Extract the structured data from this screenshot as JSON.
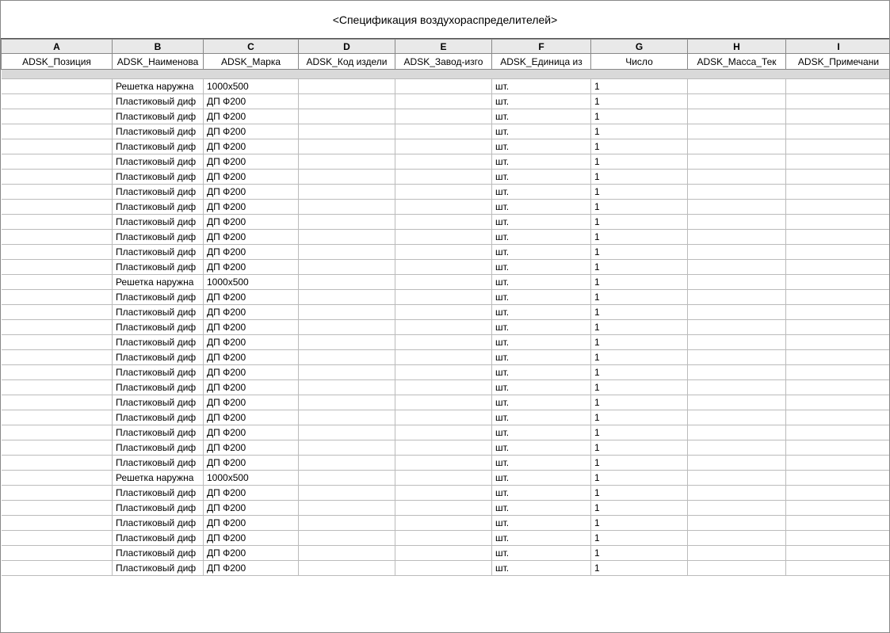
{
  "title": "<Спецификация воздухораспределителей>",
  "column_letters": [
    "A",
    "B",
    "C",
    "D",
    "E",
    "F",
    "G",
    "H",
    "I"
  ],
  "column_fields": [
    "ADSK_Позиция",
    "ADSK_Наименова",
    "ADSK_Марка",
    "ADSK_Код издели",
    "ADSK_Завод-изго",
    "ADSK_Единица из",
    "Число",
    "ADSK_Масса_Тек",
    "ADSK_Примечани"
  ],
  "rows": [
    {
      "sep": true
    },
    {
      "B": "Решетка наружна",
      "C": "1000x500",
      "F": "шт.",
      "G": "1"
    },
    {
      "B": "Пластиковый диф",
      "C": "ДП Ф200",
      "F": "шт.",
      "G": "1"
    },
    {
      "B": "Пластиковый диф",
      "C": "ДП Ф200",
      "F": "шт.",
      "G": "1"
    },
    {
      "B": "Пластиковый диф",
      "C": "ДП Ф200",
      "F": "шт.",
      "G": "1"
    },
    {
      "B": "Пластиковый диф",
      "C": "ДП Ф200",
      "F": "шт.",
      "G": "1"
    },
    {
      "B": "Пластиковый диф",
      "C": "ДП Ф200",
      "F": "шт.",
      "G": "1"
    },
    {
      "B": "Пластиковый диф",
      "C": "ДП Ф200",
      "F": "шт.",
      "G": "1"
    },
    {
      "B": "Пластиковый диф",
      "C": "ДП Ф200",
      "F": "шт.",
      "G": "1"
    },
    {
      "B": "Пластиковый диф",
      "C": "ДП Ф200",
      "F": "шт.",
      "G": "1"
    },
    {
      "B": "Пластиковый диф",
      "C": "ДП Ф200",
      "F": "шт.",
      "G": "1"
    },
    {
      "B": "Пластиковый диф",
      "C": "ДП Ф200",
      "F": "шт.",
      "G": "1"
    },
    {
      "B": "Пластиковый диф",
      "C": "ДП Ф200",
      "F": "шт.",
      "G": "1"
    },
    {
      "B": "Пластиковый диф",
      "C": "ДП Ф200",
      "F": "шт.",
      "G": "1"
    },
    {
      "B": "Решетка наружна",
      "C": "1000x500",
      "F": "шт.",
      "G": "1"
    },
    {
      "B": "Пластиковый диф",
      "C": "ДП Ф200",
      "F": "шт.",
      "G": "1"
    },
    {
      "B": "Пластиковый диф",
      "C": "ДП Ф200",
      "F": "шт.",
      "G": "1"
    },
    {
      "B": "Пластиковый диф",
      "C": "ДП Ф200",
      "F": "шт.",
      "G": "1"
    },
    {
      "B": "Пластиковый диф",
      "C": "ДП Ф200",
      "F": "шт.",
      "G": "1"
    },
    {
      "B": "Пластиковый диф",
      "C": "ДП Ф200",
      "F": "шт.",
      "G": "1"
    },
    {
      "B": "Пластиковый диф",
      "C": "ДП Ф200",
      "F": "шт.",
      "G": "1"
    },
    {
      "B": "Пластиковый диф",
      "C": "ДП Ф200",
      "F": "шт.",
      "G": "1"
    },
    {
      "B": "Пластиковый диф",
      "C": "ДП Ф200",
      "F": "шт.",
      "G": "1"
    },
    {
      "B": "Пластиковый диф",
      "C": "ДП Ф200",
      "F": "шт.",
      "G": "1"
    },
    {
      "B": "Пластиковый диф",
      "C": "ДП Ф200",
      "F": "шт.",
      "G": "1"
    },
    {
      "B": "Пластиковый диф",
      "C": "ДП Ф200",
      "F": "шт.",
      "G": "1"
    },
    {
      "B": "Пластиковый диф",
      "C": "ДП Ф200",
      "F": "шт.",
      "G": "1"
    },
    {
      "B": "Решетка наружна",
      "C": "1000x500",
      "F": "шт.",
      "G": "1"
    },
    {
      "B": "Пластиковый диф",
      "C": "ДП Ф200",
      "F": "шт.",
      "G": "1"
    },
    {
      "B": "Пластиковый диф",
      "C": "ДП Ф200",
      "F": "шт.",
      "G": "1"
    },
    {
      "B": "Пластиковый диф",
      "C": "ДП Ф200",
      "F": "шт.",
      "G": "1"
    },
    {
      "B": "Пластиковый диф",
      "C": "ДП Ф200",
      "F": "шт.",
      "G": "1"
    },
    {
      "B": "Пластиковый диф",
      "C": "ДП Ф200",
      "F": "шт.",
      "G": "1"
    },
    {
      "B": "Пластиковый диф",
      "C": "ДП Ф200",
      "F": "шт.",
      "G": "1"
    }
  ]
}
